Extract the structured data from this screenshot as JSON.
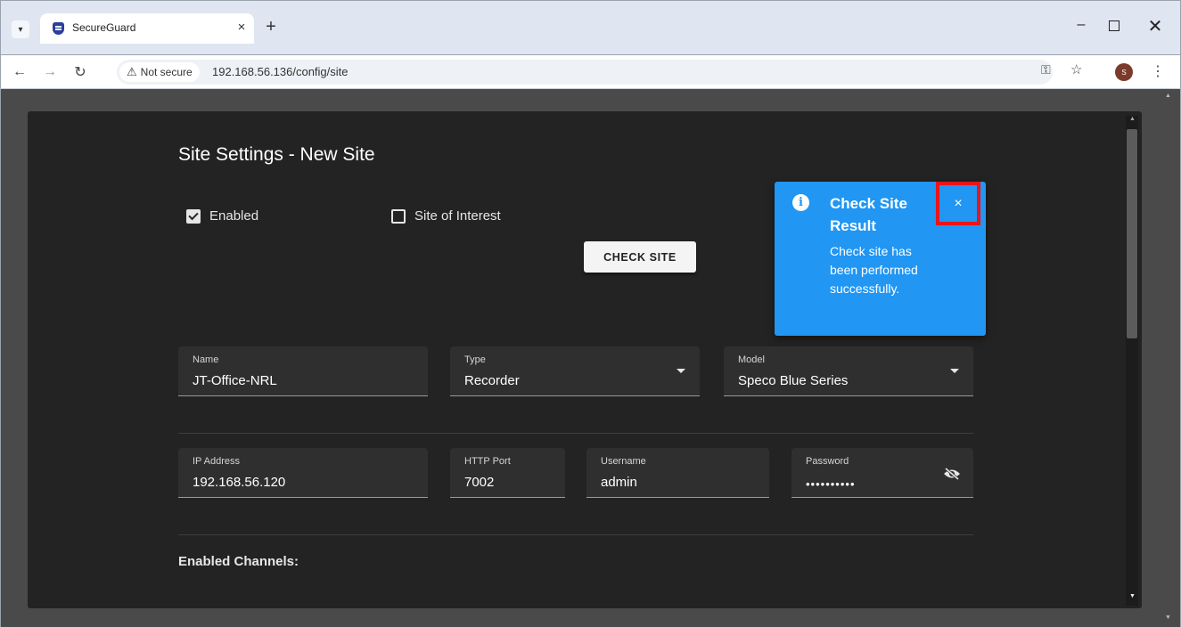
{
  "browser": {
    "tab_title": "SecureGuard",
    "tab_close": "×",
    "new_tab": "+",
    "security_label": "Not secure",
    "url": "192.168.56.136/config/site",
    "avatar_initial": "S",
    "icons": [
      "tab-search-icon",
      "shield-favicon-icon",
      "back-icon",
      "forward-icon",
      "reload-icon",
      "warning-icon",
      "key-icon",
      "star-icon",
      "more-vert-icon"
    ]
  },
  "page": {
    "title": "Site Settings - New Site",
    "enabled_label": "Enabled",
    "enabled_checked": true,
    "site_of_interest_label": "Site of Interest",
    "site_of_interest_checked": false,
    "check_site_button": "CHECK SITE",
    "toast": {
      "title": "Check Site Result",
      "message": "Check site has been performed successfully.",
      "close": "×",
      "color": "#2196f3",
      "highlight_color": "#e8151b"
    },
    "fields": {
      "name": {
        "label": "Name",
        "value": "JT-Office-NRL"
      },
      "type": {
        "label": "Type",
        "value": "Recorder"
      },
      "model": {
        "label": "Model",
        "value": "Speco Blue Series"
      },
      "ip": {
        "label": "IP Address",
        "value": "192.168.56.120"
      },
      "port": {
        "label": "HTTP Port",
        "value": "7002"
      },
      "username": {
        "label": "Username",
        "value": "admin"
      },
      "password": {
        "label": "Password",
        "value": "••••••••••"
      }
    },
    "enabled_channels_label": "Enabled Channels:"
  }
}
